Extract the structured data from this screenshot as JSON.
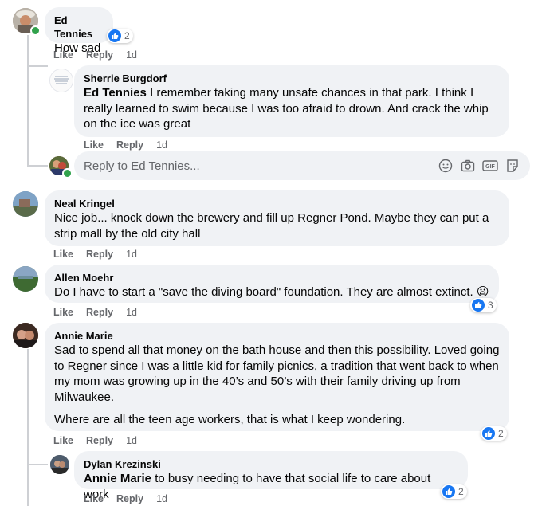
{
  "comments": [
    {
      "author": "Ed Tennies",
      "text": "How sad",
      "actions": {
        "like": "Like",
        "reply": "Reply",
        "time": "1d"
      },
      "reactions": "2"
    },
    {
      "author": "Sherrie Burgdorf",
      "mention": "Ed Tennies",
      "text": " I remember taking many unsafe chances in that park. I think I really learned to swim because I was too afraid to drown. And crack the whip on the ice was great",
      "actions": {
        "like": "Like",
        "reply": "Reply",
        "time": "1d"
      }
    },
    {
      "author": "Neal Kringel",
      "text": "Nice job... knock down the brewery and fill up Regner Pond. Maybe they can put a strip mall by the old city hall",
      "actions": {
        "like": "Like",
        "reply": "Reply",
        "time": "1d"
      }
    },
    {
      "author": "Allen Moehr",
      "text": "Do I have to start a \"save the diving board\" foundation. They are almost extinct.",
      "emoji": "😦",
      "actions": {
        "like": "Like",
        "reply": "Reply",
        "time": "1d"
      },
      "reactions": "3"
    },
    {
      "author": "Annie Marie",
      "text": "Sad to spend all that money on the bath house and then this possibility. Loved going to Regner since I was a little kid for family picnics, a tradition that went back to when my mom was growing up in the 40’s and 50’s with their family driving up from Milwaukee.",
      "text2": "Where are all the teen age workers, that is what I keep wondering.",
      "actions": {
        "like": "Like",
        "reply": "Reply",
        "time": "1d"
      },
      "reactions": "2"
    },
    {
      "author": "Dylan Krezinski",
      "mention": "Annie Marie",
      "text": " to busy needing to have that social life to care about work",
      "actions": {
        "like": "Like",
        "reply": "Reply",
        "time": "1d"
      },
      "reactions": "2"
    }
  ],
  "reply_box": {
    "placeholder": "Reply to Ed Tennies...",
    "icons": [
      "emoji-icon",
      "camera-icon",
      "gif-icon",
      "sticker-icon"
    ]
  },
  "colors": {
    "bubble": "#f0f2f5",
    "accent": "#1877f2",
    "meta": "#65676b",
    "online": "#31a24c"
  }
}
